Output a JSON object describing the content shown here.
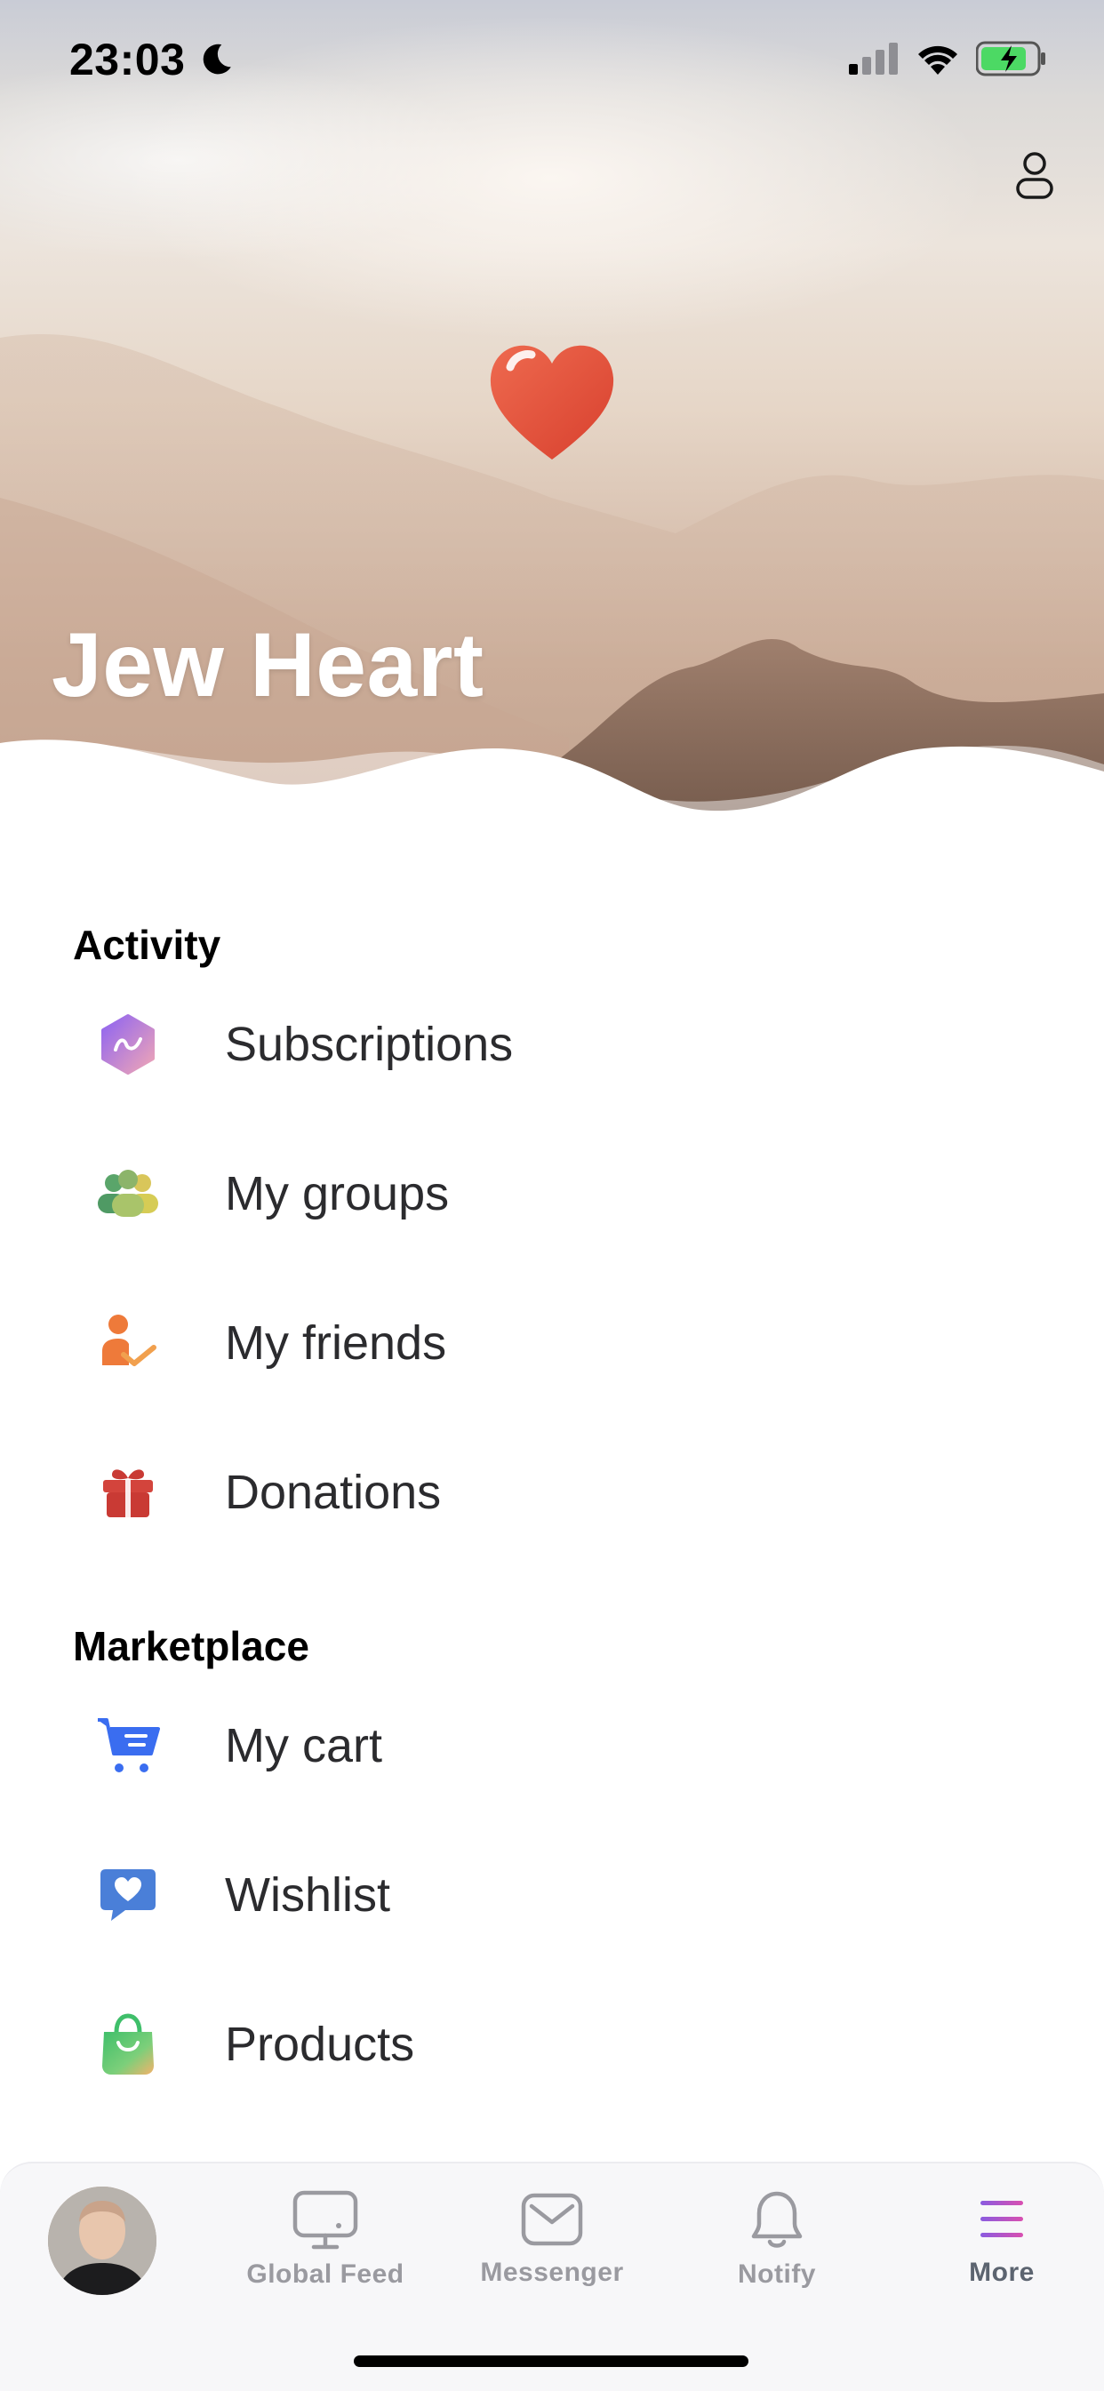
{
  "status_bar": {
    "time": "23:03",
    "icons": [
      "moon-icon",
      "cellular-signal-icon",
      "wifi-icon",
      "battery-charging-icon"
    ]
  },
  "header": {
    "title": "Jew Heart",
    "logo_icon": "red-heart-icon",
    "profile_icon": "person-outline-icon"
  },
  "sections": [
    {
      "title": "Activity",
      "items": [
        {
          "label": "Subscriptions",
          "icon": "subscriptions-icon"
        },
        {
          "label": "My groups",
          "icon": "groups-icon"
        },
        {
          "label": "My friends",
          "icon": "friends-icon"
        },
        {
          "label": "Donations",
          "icon": "gift-icon"
        }
      ]
    },
    {
      "title": "Marketplace",
      "items": [
        {
          "label": "My cart",
          "icon": "cart-icon"
        },
        {
          "label": "Wishlist",
          "icon": "wishlist-icon"
        },
        {
          "label": "Products",
          "icon": "shopping-bag-icon"
        }
      ]
    }
  ],
  "tabbar": {
    "tabs": [
      {
        "label": "Global Feed",
        "icon": "monitor-icon"
      },
      {
        "label": "Messenger",
        "icon": "envelope-icon"
      },
      {
        "label": "Notify",
        "icon": "bell-icon"
      },
      {
        "label": "More",
        "icon": "menu-icon",
        "active": true
      }
    ]
  },
  "colors": {
    "accent_more": "#7b5bd6",
    "heart": "#e2553e",
    "cart_blue": "#3a6df0",
    "gift_red": "#c93a34"
  }
}
